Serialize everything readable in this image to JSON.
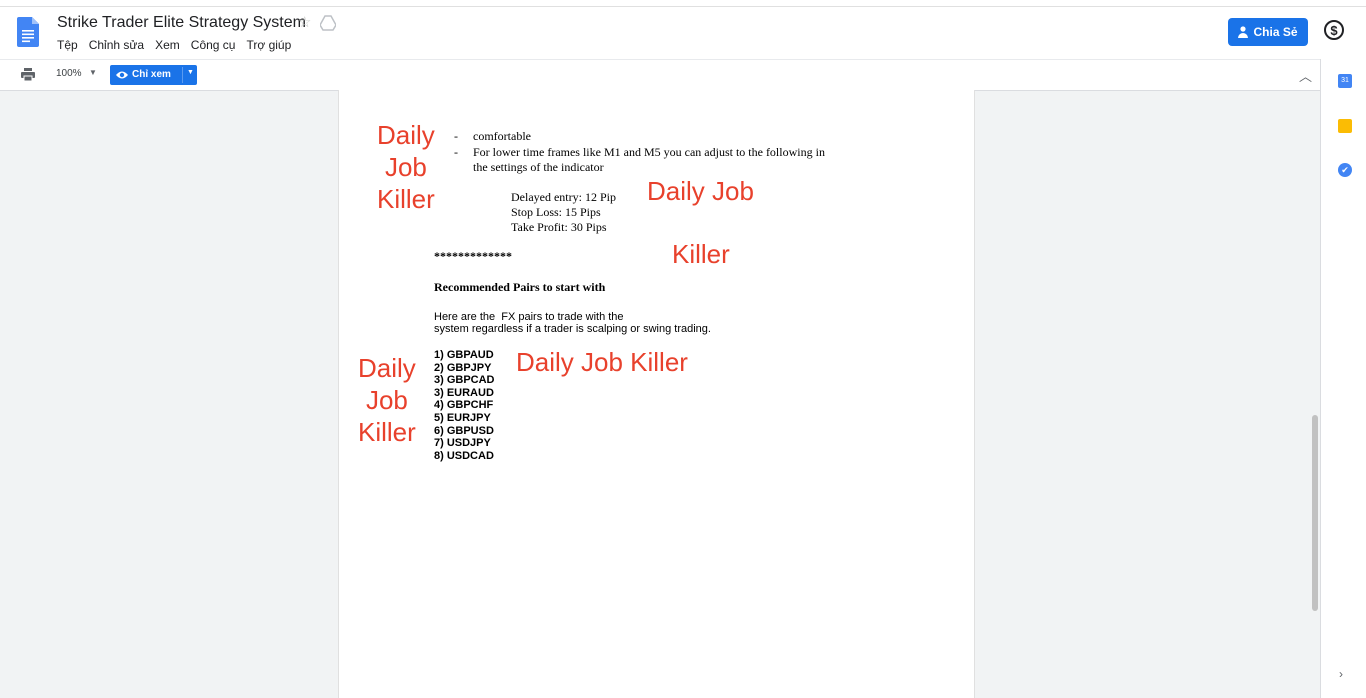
{
  "header": {
    "title": "Strike Trader Elite Strategy System",
    "menu": [
      "Tệp",
      "Chỉnh sửa",
      "Xem",
      "Công cụ",
      "Trợ giúp"
    ],
    "share_label": "Chia Sẻ",
    "currency_symbol": "$"
  },
  "toolbar": {
    "zoom": "100%",
    "view_mode": "Chỉ xem"
  },
  "document": {
    "bullets": [
      "comfortable",
      "For lower time frames like M1 and M5 you can adjust to the following in",
      "the settings of the indicator"
    ],
    "settings": [
      "Delayed entry: 12 Pip",
      "Stop Loss: 15 Pips",
      "Take Profit: 30 Pips"
    ],
    "separator": "*************",
    "heading": "Recommended Pairs to start with",
    "paragraph": [
      "Here are the  FX pairs to trade with the",
      "system regardless if a trader is scalping or swing trading."
    ],
    "pairs": [
      "1) GBPAUD",
      "2) GBPJPY",
      "3) GBPCAD",
      "3) EURAUD",
      "4) GBPCHF",
      "5) EURJPY",
      "6) GBPUSD",
      "7) USDJPY",
      "8) USDCAD"
    ]
  },
  "watermarks": {
    "w1": [
      "Daily",
      "Job",
      "Killer"
    ],
    "w2": "Daily Job",
    "w3": "Killer",
    "w4": "Daily Job Killer",
    "w5": [
      "Daily",
      "Job",
      "Killer"
    ]
  },
  "side_panel": {
    "calendar_day": "31"
  },
  "colors": {
    "accent": "#1a73e8",
    "watermark": "#e8412c"
  }
}
